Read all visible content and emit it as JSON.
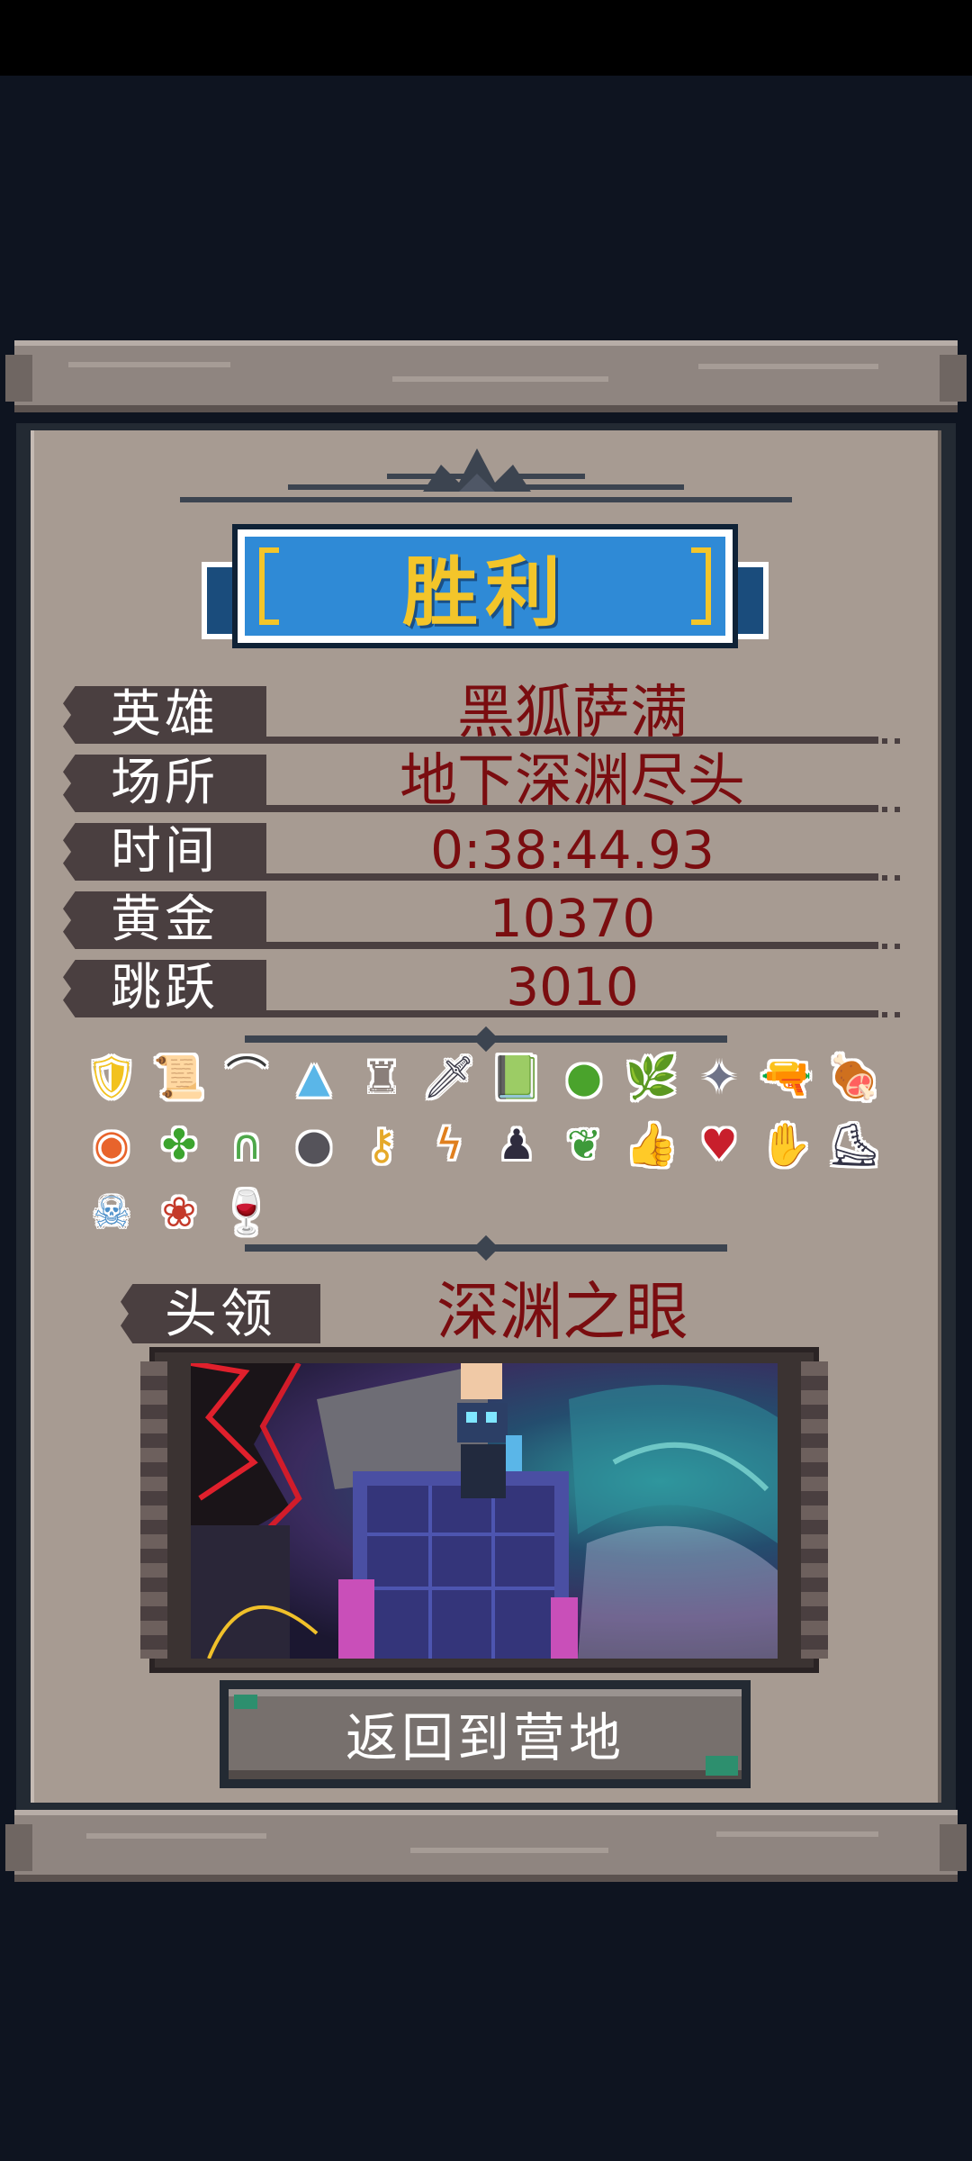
{
  "result": {
    "title": "胜利"
  },
  "stats": [
    {
      "label": "英雄",
      "value": "黑狐萨满"
    },
    {
      "label": "场所",
      "value": "地下深渊尽头"
    },
    {
      "label": "时间",
      "value": "0:38:44.93"
    },
    {
      "label": "黄金",
      "value": "10370"
    },
    {
      "label": "跳跃",
      "value": "3010"
    }
  ],
  "items": [
    {
      "icon": "golden-shield-icon",
      "glyph": "🛡",
      "color": "#f2c21f"
    },
    {
      "icon": "leather-scroll-icon",
      "glyph": "📜",
      "color": "#9a4e2c"
    },
    {
      "icon": "boomerang-icon",
      "glyph": "⌒",
      "color": "#3a3a3a"
    },
    {
      "icon": "ice-crystal-icon",
      "glyph": "▲",
      "color": "#5ab6e8"
    },
    {
      "icon": "tower-icon",
      "glyph": "♜",
      "color": "#8a7f7a"
    },
    {
      "icon": "dark-sword-icon",
      "glyph": "🗡",
      "color": "#3c3b49"
    },
    {
      "icon": "spellbook-icon",
      "glyph": "📗",
      "color": "#1e9c66"
    },
    {
      "icon": "green-slime-icon",
      "glyph": "●",
      "color": "#4aa32c"
    },
    {
      "icon": "green-branch-icon",
      "glyph": "🌿",
      "color": "#2f8f3a"
    },
    {
      "icon": "shuriken-icon",
      "glyph": "✦",
      "color": "#6f7388"
    },
    {
      "icon": "rifle-icon",
      "glyph": "🔫",
      "color": "#2e3346"
    },
    {
      "icon": "meat-leg-icon",
      "glyph": "🍖",
      "color": "#8a3f2a"
    },
    {
      "icon": "fire-orb-icon",
      "glyph": "◉",
      "color": "#e8642c"
    },
    {
      "icon": "whirlwind-icon",
      "glyph": "✤",
      "color": "#3ca42e"
    },
    {
      "icon": "leaf-arm-icon",
      "glyph": "∩",
      "color": "#4ea84a"
    },
    {
      "icon": "bomb-icon",
      "glyph": "●",
      "color": "#55535a"
    },
    {
      "icon": "golden-key-icon",
      "glyph": "⚷",
      "color": "#e5a92a"
    },
    {
      "icon": "lightning-bolt-icon",
      "glyph": "ϟ",
      "color": "#e0801f"
    },
    {
      "icon": "dark-robe-icon",
      "glyph": "♟",
      "color": "#2f2c3e"
    },
    {
      "icon": "leaf-icon",
      "glyph": "❦",
      "color": "#3d9a3a"
    },
    {
      "icon": "thumbs-up-icon",
      "glyph": "👍",
      "color": "#f0c9a6"
    },
    {
      "icon": "broken-heart-icon",
      "glyph": "♥",
      "color": "#c81f2c"
    },
    {
      "icon": "open-hand-icon",
      "glyph": "✋",
      "color": "#f2b61e"
    },
    {
      "icon": "roller-skate-icon",
      "glyph": "⛸",
      "color": "#333346"
    },
    {
      "icon": "skull-bones-icon",
      "glyph": "☠",
      "color": "#4c8fc9"
    },
    {
      "icon": "carnivorous-plant-icon",
      "glyph": "❀",
      "color": "#c43a2a"
    },
    {
      "icon": "purple-chalice-icon",
      "glyph": "🍷",
      "color": "#6f3fa0"
    }
  ],
  "boss": {
    "label": "头领",
    "name": "深渊之眼"
  },
  "actions": {
    "return_label": "返回到营地"
  }
}
